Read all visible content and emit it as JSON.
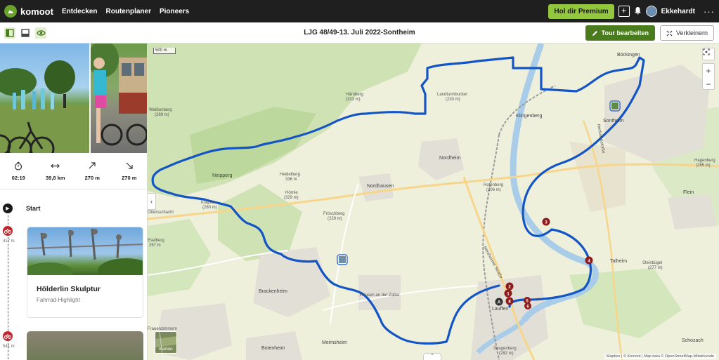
{
  "nav": {
    "brand": "komoot",
    "links": [
      "Entdecken",
      "Routenplaner",
      "Pioneers"
    ],
    "premium": "Hol dir Premium",
    "username": "Ekkehardt",
    "more": "···"
  },
  "subbar": {
    "title": "LJG 48/49-13. Juli 2022-Sontheim",
    "edit": "Tour bearbeiten",
    "shrink": "Verkleinern"
  },
  "stats": {
    "duration": "02:19",
    "distance": "39,8 km",
    "uphill": "270 m",
    "downhill": "270 m"
  },
  "timeline": {
    "start": "Start",
    "wp1_dist": "417 m",
    "wp2_dist": "541 m",
    "highlight_title": "Hölderlin Skulptur",
    "highlight_type": "Fahrrad-Highlight"
  },
  "map": {
    "scale": "500 m",
    "layers_label": "Karten",
    "attribution": "Mapbox | © Komoot | Map data © OpenStreetMap-Mitwirkende",
    "places": {
      "boeckingen": "Böckingen",
      "sontheim": "Sontheim",
      "nordheim": "Nordheim",
      "nordhausen": "Nordhausen",
      "klingenberg": "Klingenberg",
      "brackenheim": "Brackenheim",
      "hausen": "Hausen an der Zaber",
      "meimsheim": "Meimsheim",
      "botenheim": "Botenheim",
      "neipperg": "Neipperg",
      "flein": "Flein",
      "talheim": "Talheim",
      "schozach": "Schozach",
      "frauenzimmern": "Frauenzimmern",
      "lauffen": "Lauffen",
      "ottersschacht": "Ottersschacht"
    },
    "peaks": {
      "haernberg": "Härnberg",
      "haernberg_alt": "(323 m)",
      "landturmbuckel": "Landturmbuckel",
      "landturmbuckel_alt": "(233 m)",
      "weissenberg": "Weißenberg",
      "weissenberg_alt": "(269 m)",
      "heidelberg": "Heidelberg",
      "heidelberg_alt": "336 m",
      "hoernle": "Hörnle",
      "hoernle_alt": "(329 m)",
      "kraeplen": "Kräplen",
      "kraeplen_alt": "(280 m)",
      "froeschberg": "Fröschberg",
      "froeschberg_alt": "(229 m)",
      "eselberg": "Eselberg",
      "eselberg_alt": "257 m",
      "rotenberg": "Rotenberg",
      "rotenberg_alt": "(206 m)",
      "hagenberg": "Hagenberg",
      "hagenberg_alt": "(285 m)",
      "steinbuegel": "Steinbügel",
      "steinbuegel_alt": "(277 m)",
      "seugenberg": "Seugenberg",
      "seugenberg_alt": "(282 m)"
    },
    "roads": {
      "nordheimer": "Nordheimer Straße",
      "neckartal": "Neckartalstraße"
    },
    "markers": [
      "1",
      "2",
      "3",
      "4",
      "5",
      "6",
      "8",
      "A"
    ]
  },
  "icons": {
    "logo": "komoot-logo-icon",
    "plus": "plus-icon",
    "bell": "bell-icon",
    "view_sidebar": "sidebar-view-icon",
    "view_bottom": "bottom-view-icon",
    "eye": "eye-icon",
    "pencil": "pencil-icon",
    "shrink": "shrink-icon",
    "locate": "locate-icon"
  },
  "colors": {
    "route": "#1355c4",
    "brand_green": "#6aa127",
    "premium": "#93c83e",
    "edit_button": "#4a7c1e",
    "waypoint": "#c0272d"
  }
}
